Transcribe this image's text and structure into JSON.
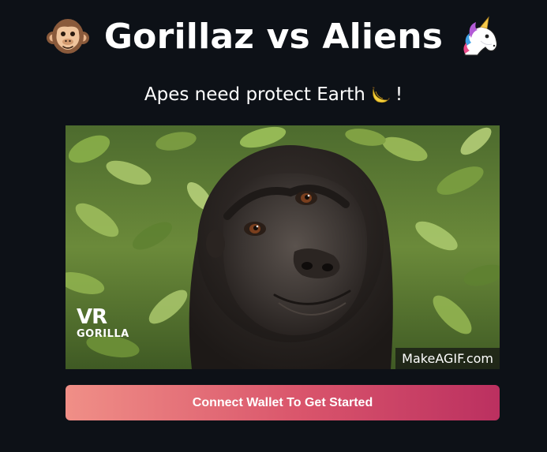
{
  "header": {
    "title": "Gorillaz vs Aliens",
    "left_icon": "monkey-face-icon",
    "right_icon": "unicorn-icon"
  },
  "subtitle": {
    "text": "Apes need protect Earth",
    "icon": "banana-icon",
    "suffix": "!"
  },
  "media": {
    "description_icon": "gorilla-gif",
    "logo_line1": "VR",
    "logo_line2": "GORILLA",
    "watermark": "MakeAGIF.com"
  },
  "cta": {
    "label": "Connect Wallet To Get Started"
  },
  "colors": {
    "background": "#0d1117",
    "button_gradient_start": "#f08f87",
    "button_gradient_end": "#bb3060"
  }
}
